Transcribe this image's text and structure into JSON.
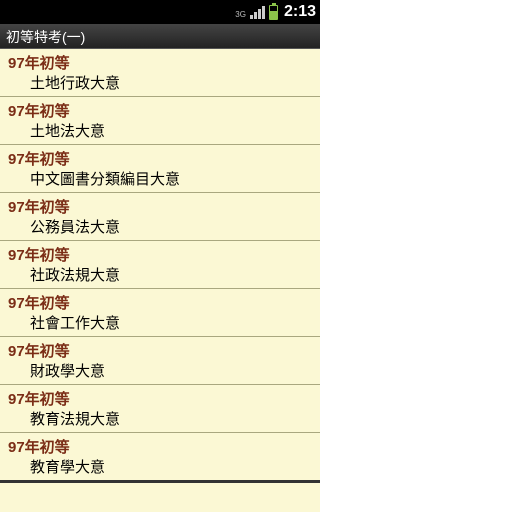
{
  "status": {
    "network_label": "3G",
    "time": "2:13"
  },
  "header": {
    "title": "初等特考(一)"
  },
  "exam_year_label": "97年初等",
  "list": [
    {
      "title": "97年初等",
      "sub": "土地行政大意"
    },
    {
      "title": "97年初等",
      "sub": "土地法大意"
    },
    {
      "title": "97年初等",
      "sub": "中文圖書分類編目大意"
    },
    {
      "title": "97年初等",
      "sub": "公務員法大意"
    },
    {
      "title": "97年初等",
      "sub": "社政法規大意"
    },
    {
      "title": "97年初等",
      "sub": "社會工作大意"
    },
    {
      "title": "97年初等",
      "sub": "財政學大意"
    },
    {
      "title": "97年初等",
      "sub": "教育法規大意"
    },
    {
      "title": "97年初等",
      "sub": "教育學大意"
    }
  ]
}
